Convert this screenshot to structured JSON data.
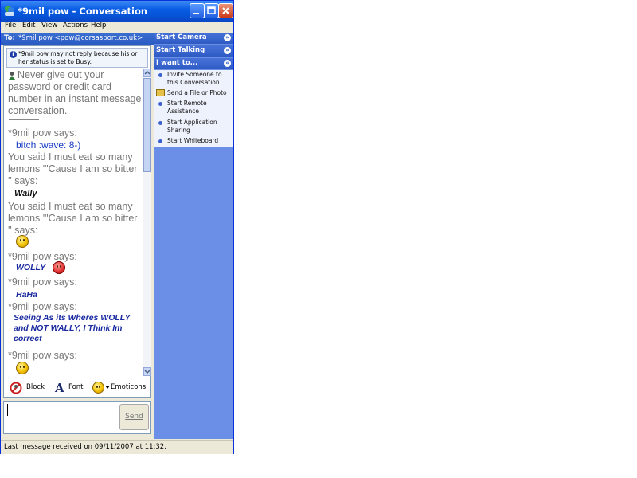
{
  "window": {
    "title": "*9mil pow - Conversation",
    "menu": [
      "File",
      "Edit",
      "View",
      "Actions",
      "Help"
    ]
  },
  "to_bar": {
    "label": "To:",
    "contact": "*9mil pow <pow@corsasport.co.uk>"
  },
  "info": {
    "text": "*9mil pow may not reply because his or her status is set to Busy."
  },
  "messages": {
    "warning": [
      "Never give out your",
      "password or credit card",
      "number in an instant message",
      "conversation."
    ],
    "m1_says": "*9mil pow says:",
    "m1_text": "bitch :wave: 8-)",
    "m2_l1": "You said I must eat so many",
    "m2_l2": "lemons '\"Cause I am so bitter",
    "m2_l3": "'' says:",
    "m2_text": "Wally",
    "m3_l1": "You said I must eat so many",
    "m3_l2": "lemons '\"Cause I am so bitter",
    "m3_l3": "'' says:",
    "m4_says": "*9mil pow says:",
    "m4_text": "WOLLY",
    "m5_says": "*9mil pow says:",
    "m5_text": "HaHa",
    "m6_says": "*9mil pow says:",
    "m6_l1": "Seeing As its Wheres WOLLY",
    "m6_l2": "and NOT WALLY, I Think Im",
    "m6_l3": "correct",
    "m7_says": "*9mil pow says:"
  },
  "toolbar": {
    "block": "Block",
    "font": "Font",
    "emoticons": "Emoticons"
  },
  "input": {
    "send": "Send"
  },
  "status": {
    "text": "Last message received on 09/11/2007 at 11:32."
  },
  "side": {
    "start_camera": "Start Camera",
    "start_talking": "Start Talking",
    "i_want_to": "I want to...",
    "items": [
      "Invite Someone to this Conversation",
      "Send a File or Photo",
      "Start Remote Assistance",
      "Start Application Sharing",
      "Start Whiteboard"
    ]
  }
}
